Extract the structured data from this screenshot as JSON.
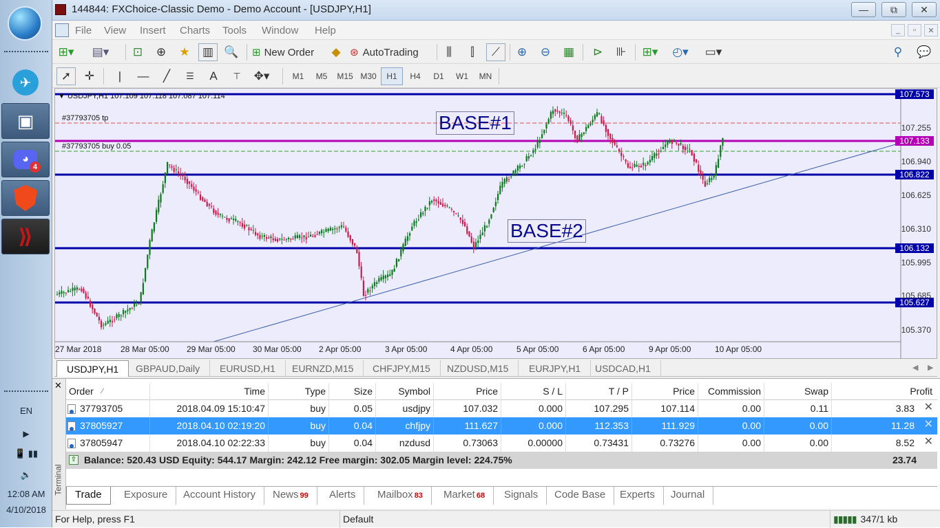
{
  "taskbar": {
    "language": "EN",
    "clock_time": "12:08 AM",
    "clock_date": "4/10/2018",
    "discord_badge": "4"
  },
  "window": {
    "title": "144844: FXChoice-Classic Demo - Demo Account - [USDJPY,H1]",
    "buttons": {
      "minimize": "—",
      "maximize": "⧉",
      "close": "✕"
    }
  },
  "menu": [
    "File",
    "View",
    "Insert",
    "Charts",
    "Tools",
    "Window",
    "Help"
  ],
  "toolbar": {
    "new_order": "New Order",
    "autotrading": "AutoTrading",
    "timeframes": [
      "M1",
      "M5",
      "M15",
      "M30",
      "H1",
      "H4",
      "D1",
      "W1",
      "MN"
    ],
    "active_timeframe": "H1"
  },
  "chart": {
    "symbol_line": "USDJPY,H1  107.109 107.118 107.087 107.114",
    "tp_label": "#37793705 tp",
    "order_label": "#37793705 buy 0.05",
    "base1": "BASE#1",
    "base2": "BASE#2",
    "price_ticks": [
      "107.255",
      "106.940",
      "106.625",
      "106.310",
      "105.995",
      "105.685",
      "105.370"
    ],
    "hline_tags": [
      "107.573",
      "107.133",
      "106.822",
      "106.132",
      "105.627"
    ],
    "time_ticks": [
      "27 Mar 2018",
      "28 Mar 05:00",
      "29 Mar 05:00",
      "30 Mar 05:00",
      "2 Apr 05:00",
      "3 Apr 05:00",
      "4 Apr 05:00",
      "5 Apr 05:00",
      "6 Apr 05:00",
      "9 Apr 05:00",
      "10 Apr 05:00"
    ],
    "colors": {
      "bull": "#0b7a1c",
      "bear": "#d0184a",
      "hline": "#0000a8",
      "order_line": "#b400b4",
      "background": "#ececfc"
    }
  },
  "symbol_tabs": [
    "USDJPY,H1",
    "GBPAUD,Daily",
    "EURUSD,H1",
    "EURNZD,M15",
    "CHFJPY,M15",
    "NZDUSD,M15",
    "EURJPY,H1",
    "USDCAD,H1"
  ],
  "terminal": {
    "side_label": "Terminal",
    "columns": [
      "Order",
      "Time",
      "Type",
      "Size",
      "Symbol",
      "Price",
      "S / L",
      "T / P",
      "Price",
      "Commission",
      "Swap",
      "Profit"
    ],
    "rows": [
      [
        "37793705",
        "2018.04.09 15:10:47",
        "buy",
        "0.05",
        "usdjpy",
        "107.032",
        "0.000",
        "107.295",
        "107.114",
        "0.00",
        "0.11",
        "3.83"
      ],
      [
        "37805927",
        "2018.04.10 02:19:20",
        "buy",
        "0.04",
        "chfjpy",
        "111.627",
        "0.000",
        "112.353",
        "111.929",
        "0.00",
        "0.00",
        "11.28"
      ],
      [
        "37805947",
        "2018.04.10 02:22:33",
        "buy",
        "0.04",
        "nzdusd",
        "0.73063",
        "0.00000",
        "0.73431",
        "0.73276",
        "0.00",
        "0.00",
        "8.52"
      ]
    ],
    "balance_line": "Balance: 520.43 USD  Equity: 544.17  Margin: 242.12  Free margin: 302.05  Margin level: 224.75%",
    "total_profit": "23.74",
    "tabs": [
      {
        "label": "Trade",
        "badge": ""
      },
      {
        "label": "Exposure",
        "badge": ""
      },
      {
        "label": "Account History",
        "badge": ""
      },
      {
        "label": "News",
        "badge": "99"
      },
      {
        "label": "Alerts",
        "badge": ""
      },
      {
        "label": "Mailbox",
        "badge": "83"
      },
      {
        "label": "Market",
        "badge": "68"
      },
      {
        "label": "Signals",
        "badge": ""
      },
      {
        "label": "Code Base",
        "badge": ""
      },
      {
        "label": "Experts",
        "badge": ""
      },
      {
        "label": "Journal",
        "badge": ""
      }
    ]
  },
  "status": {
    "help": "For Help, press F1",
    "profile": "Default",
    "traffic": "347/1 kb"
  }
}
